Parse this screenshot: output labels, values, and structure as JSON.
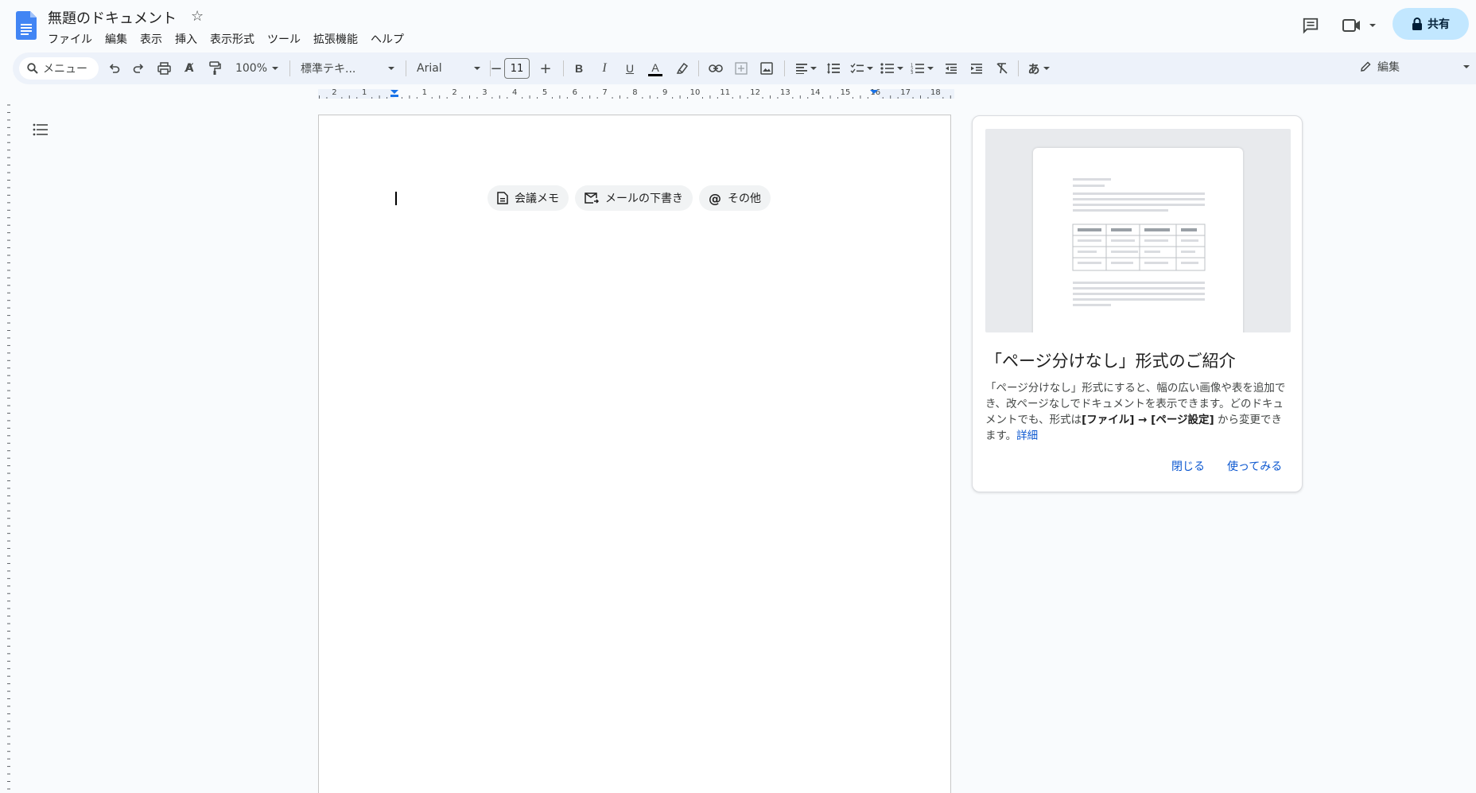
{
  "header": {
    "title": "無題のドキュメント",
    "star_icon": "star-icon",
    "menu": [
      "ファイル",
      "編集",
      "表示",
      "挿入",
      "表示形式",
      "ツール",
      "拡張機能",
      "ヘルプ"
    ],
    "share_label": "共有"
  },
  "toolbar": {
    "search_label": "メニュー",
    "zoom": "100%",
    "style": "標準テキ...",
    "font": "Arial",
    "font_size": "11",
    "input_tool": "あ",
    "edit_mode": "編集"
  },
  "ruler": {
    "numbers": [
      "2",
      "1",
      "1",
      "2",
      "3",
      "4",
      "5",
      "6",
      "7",
      "8",
      "9",
      "10",
      "11",
      "12",
      "13",
      "14",
      "15",
      "16",
      "17",
      "18"
    ]
  },
  "document": {
    "chips": [
      {
        "label": "会議メモ",
        "icon": "doc-icon"
      },
      {
        "label": "メールの下書き",
        "icon": "mail-icon"
      },
      {
        "label": "その他",
        "icon": "at-icon"
      }
    ]
  },
  "popup": {
    "title": "「ページ分けなし」形式のご紹介",
    "body_part1": "「ページ分けなし」形式にすると、幅の広い画像や表を追加でき、改ページなしでドキュメントを表示できます。どのドキュメントでも、形式は",
    "body_bold": "[ファイル] → [ページ設定]",
    "body_part2": "から変更できます。",
    "link": "詳細",
    "close": "閉じる",
    "try": "使ってみる"
  },
  "colors": {
    "accent": "#0b57d0",
    "share_bg": "#c2e7ff",
    "toolbar_bg": "#edf2fa",
    "docs_blue": "#4285f4"
  }
}
